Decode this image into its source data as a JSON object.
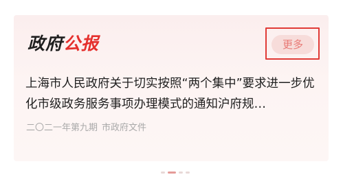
{
  "header": {
    "title_part1": "政府",
    "title_part2": "公报",
    "more_label": "更多"
  },
  "article": {
    "title": "上海市人民政府关于切实按照“两个集中”要求进一步优化市级政务服务事项办理模式的通知沪府规…",
    "issue": "二〇二一年第九期",
    "category": "市政府文件"
  },
  "carousel": {
    "page_count": 4,
    "active_index": 1
  },
  "colors": {
    "accent": "#e5302d",
    "card_background": "#fdf4f3",
    "highlight_border": "#e03a36"
  }
}
